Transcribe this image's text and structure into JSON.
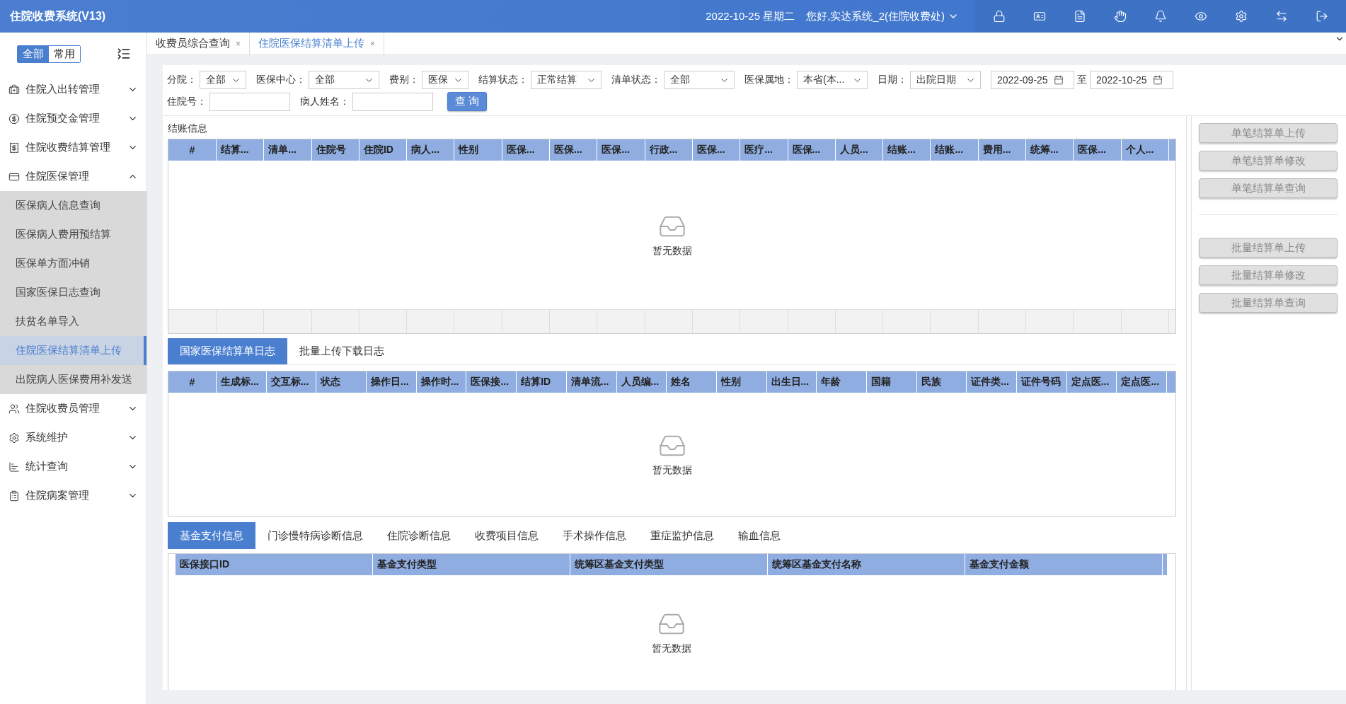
{
  "app": {
    "title": "住院收费系统(V13)"
  },
  "header": {
    "date": "2022-10-25 星期二",
    "user": "您好,实达系统_2(住院收费处)"
  },
  "sidebar": {
    "modes": [
      {
        "label": "全部",
        "selected": true
      },
      {
        "label": "常用",
        "selected": false
      }
    ],
    "items": [
      {
        "label": "住院入出转管理",
        "expanded": false
      },
      {
        "label": "住院预交金管理",
        "expanded": false
      },
      {
        "label": "住院收费结算管理",
        "expanded": false
      },
      {
        "label": "住院医保管理",
        "expanded": true,
        "children": [
          {
            "label": "医保病人信息查询",
            "selected": false
          },
          {
            "label": "医保病人费用预结算",
            "selected": false
          },
          {
            "label": "医保单方面冲销",
            "selected": false
          },
          {
            "label": "国家医保日志查询",
            "selected": false
          },
          {
            "label": "扶贫名单导入",
            "selected": false
          },
          {
            "label": "住院医保结算清单上传",
            "selected": true
          },
          {
            "label": "出院病人医保费用补发送",
            "selected": false
          }
        ]
      },
      {
        "label": "住院收费员管理",
        "expanded": false
      },
      {
        "label": "系统维护",
        "expanded": false
      },
      {
        "label": "统计查询",
        "expanded": false
      },
      {
        "label": "住院病案管理",
        "expanded": false
      }
    ]
  },
  "tabs": [
    {
      "label": "收费员综合查询",
      "close": "×",
      "selected": false
    },
    {
      "label": "住院医保结算清单上传",
      "close": "×",
      "selected": true
    }
  ],
  "filter_rows": [
    [
      {
        "kind": "select",
        "label": "分院：",
        "value": "全部"
      },
      {
        "kind": "select",
        "label": "医保中心：",
        "value": "全部"
      },
      {
        "kind": "select",
        "label": "费别：",
        "value": "医保"
      },
      {
        "kind": "select",
        "label": "结算状态：",
        "value": "正常结算"
      },
      {
        "kind": "select",
        "label": "清单状态：",
        "value": "全部"
      },
      {
        "kind": "select",
        "label": "医保属地：",
        "value": "本省(本..."
      },
      {
        "kind": "select",
        "label": "日期：",
        "value": "出院日期"
      },
      {
        "kind": "daterange",
        "from": "2022-09-25",
        "separator": "至",
        "to": "2022-10-25"
      }
    ],
    [
      {
        "kind": "input",
        "label": "住院号："
      },
      {
        "kind": "input",
        "label": "病人姓名："
      },
      {
        "kind": "button",
        "label": "查 询"
      }
    ]
  ],
  "billing": {
    "title": "结账信息",
    "columns": [
      "#",
      "结算...",
      "清单...",
      "住院号",
      "住院ID",
      "病人...",
      "性别",
      "医保...",
      "医保...",
      "医保...",
      "行政...",
      "医保...",
      "医疗...",
      "医保...",
      "人员...",
      "结账...",
      "结账...",
      "费用...",
      "统筹...",
      "医保...",
      "个人..."
    ],
    "empty_text": "暂无数据"
  },
  "log_tabs": [
    {
      "label": "国家医保结算单日志",
      "selected": true
    },
    {
      "label": "批量上传下载日志",
      "selected": false
    }
  ],
  "log_table": {
    "columns": [
      "#",
      "生成标...",
      "交互标...",
      "状态",
      "操作日...",
      "操作时...",
      "医保接...",
      "结算ID",
      "清单流...",
      "人员编...",
      "姓名",
      "性别",
      "出生日...",
      "年龄",
      "国籍",
      "民族",
      "证件类...",
      "证件号码",
      "定点医...",
      "定点医..."
    ],
    "empty_text": "暂无数据"
  },
  "detail_tabs": [
    {
      "label": "基金支付信息",
      "selected": true
    },
    {
      "label": "门诊慢特病诊断信息",
      "selected": false
    },
    {
      "label": "住院诊断信息",
      "selected": false
    },
    {
      "label": "收费项目信息",
      "selected": false
    },
    {
      "label": "手术操作信息",
      "selected": false
    },
    {
      "label": "重症监护信息",
      "selected": false
    },
    {
      "label": "输血信息",
      "selected": false
    }
  ],
  "detail_table": {
    "columns": [
      "医保接口ID",
      "基金支付类型",
      "统筹区基金支付类型",
      "统筹区基金支付名称",
      "基金支付金额"
    ],
    "empty_text": "暂无数据"
  },
  "action_groups": [
    [
      {
        "label": "单笔结算单上传",
        "disabled": true
      },
      {
        "label": "单笔结算单修改",
        "disabled": true
      },
      {
        "label": "单笔结算单查询",
        "disabled": true
      }
    ],
    [
      {
        "label": "批量结算单上传",
        "disabled": true
      },
      {
        "label": "批量结算单修改",
        "disabled": true
      },
      {
        "label": "批量结算单查询",
        "disabled": true
      }
    ]
  ]
}
